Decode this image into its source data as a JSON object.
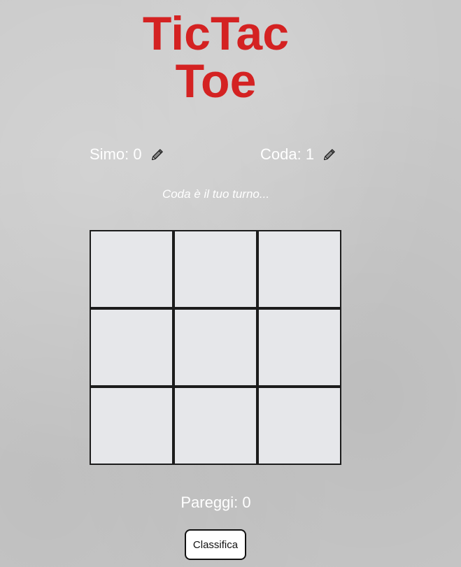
{
  "title": {
    "line1": "TicTac",
    "line2": "Toe"
  },
  "players": [
    {
      "label": "Simo: 0",
      "edit_icon": "pencil-icon"
    },
    {
      "label": "Coda: 1",
      "edit_icon": "pencil-icon"
    }
  ],
  "status": {
    "turn_message": "Coda è il tuo turno..."
  },
  "board": {
    "cells": [
      "",
      "",
      "",
      "",
      "",
      "",
      "",
      "",
      ""
    ]
  },
  "draws": {
    "label": "Pareggi: 0"
  },
  "buttons": {
    "leaderboard": "Classifica"
  },
  "colors": {
    "title": "#d42222",
    "background": "#c9c9c9",
    "cell": "#e6e7ea",
    "grid": "#1c1c1c"
  }
}
